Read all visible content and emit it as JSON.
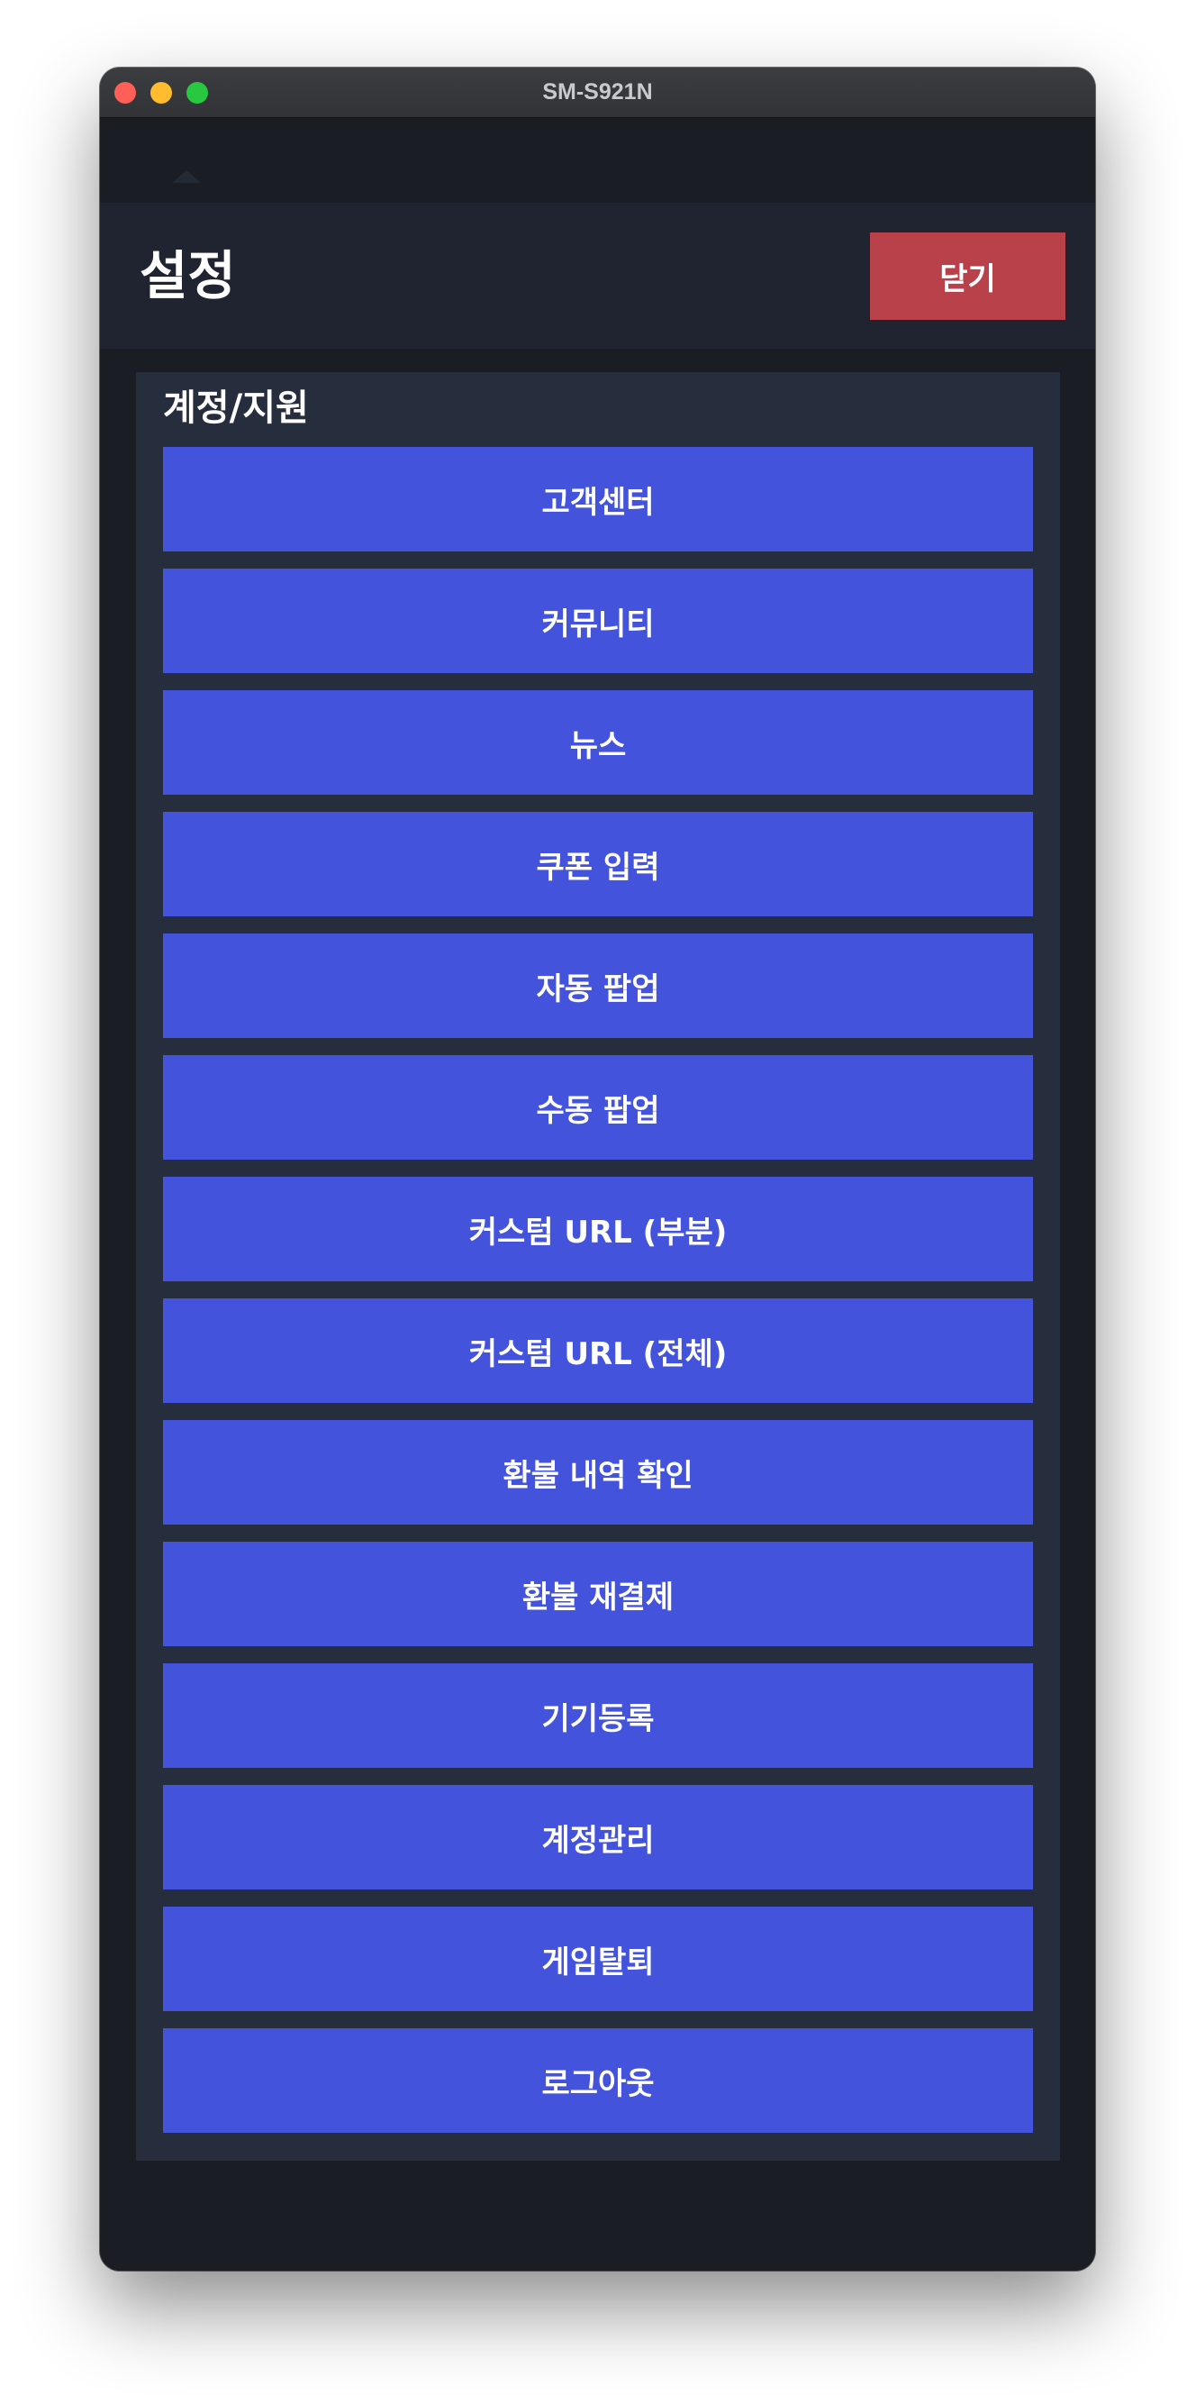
{
  "window": {
    "title": "SM-S921N"
  },
  "header": {
    "title": "설정",
    "close_label": "닫기"
  },
  "section": {
    "title": "계정/지원",
    "items": [
      {
        "label": "고객센터"
      },
      {
        "label": "커뮤니티"
      },
      {
        "label": "뉴스"
      },
      {
        "label": "쿠폰 입력"
      },
      {
        "label": "자동 팝업"
      },
      {
        "label": "수동 팝업"
      },
      {
        "label": "커스텀 URL (부분)"
      },
      {
        "label": "커스텀 URL (전체)"
      },
      {
        "label": "환불 내역 확인"
      },
      {
        "label": "환불 재결제"
      },
      {
        "label": "기기등록"
      },
      {
        "label": "계정관리"
      },
      {
        "label": "게임탈퇴"
      },
      {
        "label": "로그아웃"
      }
    ]
  },
  "colors": {
    "header_bg": "#1f2430",
    "panel_bg": "#262d3d",
    "menu_button": "#4353dc",
    "close_button": "#b8414a"
  }
}
